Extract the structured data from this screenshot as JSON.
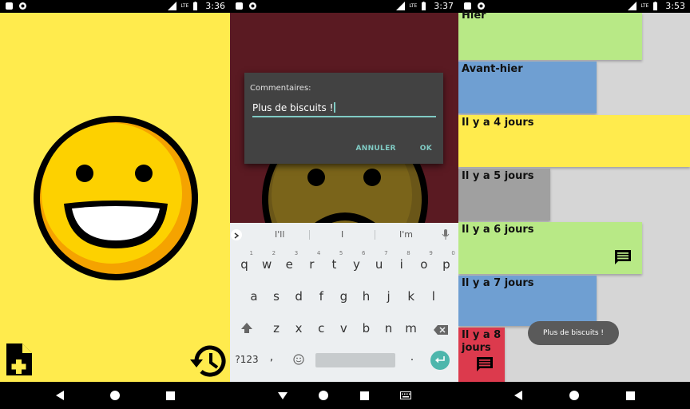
{
  "screen1": {
    "status": {
      "network": "LTE",
      "time": "3:36"
    },
    "mood_icon": "laughing-smiley-icon",
    "add_icon": "note-add-icon",
    "history_icon": "history-icon",
    "colors": {
      "background": "#ffeb4d",
      "face": "#fdd100",
      "face_shadow": "#f5a300"
    }
  },
  "screen2": {
    "status": {
      "network": "LTE",
      "time": "3:37"
    },
    "dialog": {
      "title": "Commentaires:",
      "value": "Plus de biscuits !",
      "cancel_label": "ANNULER",
      "ok_label": "OK"
    },
    "keyboard": {
      "suggestions": [
        "I'll",
        "I",
        "I'm"
      ],
      "row1": [
        {
          "k": "q",
          "n": "1"
        },
        {
          "k": "w",
          "n": "2"
        },
        {
          "k": "e",
          "n": "3"
        },
        {
          "k": "r",
          "n": "4"
        },
        {
          "k": "t",
          "n": "5"
        },
        {
          "k": "y",
          "n": "6"
        },
        {
          "k": "u",
          "n": "7"
        },
        {
          "k": "i",
          "n": "8"
        },
        {
          "k": "o",
          "n": "9"
        },
        {
          "k": "p",
          "n": "0"
        }
      ],
      "row2": [
        "a",
        "s",
        "d",
        "f",
        "g",
        "h",
        "j",
        "k",
        "l"
      ],
      "row3": [
        "z",
        "x",
        "c",
        "v",
        "b",
        "n",
        "m"
      ],
      "symbols_label": "?123",
      "comma": ",",
      "period": "."
    },
    "colors": {
      "background": "#5a1a22",
      "accent": "#80cbc4"
    }
  },
  "screen3": {
    "status": {
      "network": "LTE",
      "time": "3:53"
    },
    "days": [
      {
        "label": "Hier",
        "color": "#b8e986",
        "has_comment": false
      },
      {
        "label": "Avant-hier",
        "color": "#6f9fd2",
        "has_comment": false
      },
      {
        "label": "Il y a 4 jours",
        "color": "#ffeb4d",
        "has_comment": false
      },
      {
        "label": "Il y a 5 jours",
        "color": "#a0a0a0",
        "has_comment": false
      },
      {
        "label": "Il y a 6 jours",
        "color": "#b8e986",
        "has_comment": true
      },
      {
        "label": "Il y a 7 jours",
        "color": "#6f9fd2",
        "has_comment": false
      },
      {
        "label": "Il y a 8 jours",
        "color": "#dc3a4d",
        "has_comment": true
      }
    ],
    "toast": "Plus de biscuits !"
  }
}
